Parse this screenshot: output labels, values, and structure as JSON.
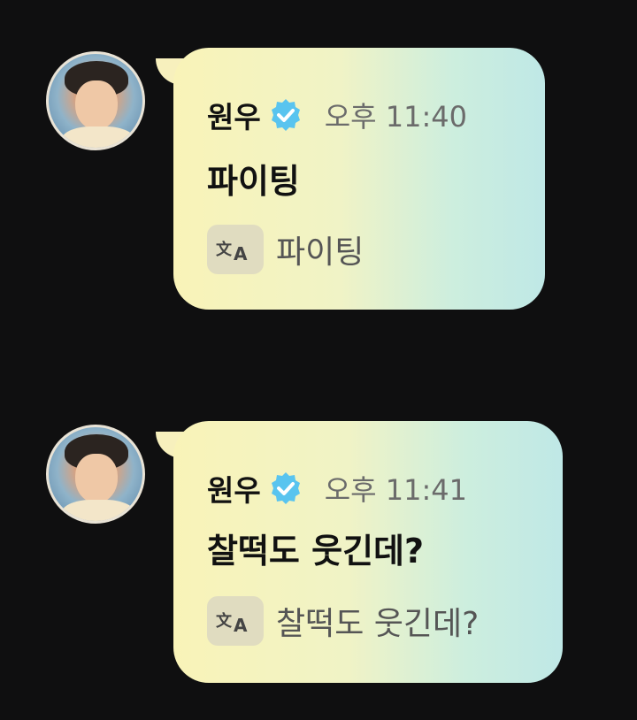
{
  "colors": {
    "background": "#0f0f10",
    "bubble_start": "#f9f3b8",
    "bubble_end": "#bfe8e6",
    "verified_badge": "#59c4ef"
  },
  "messages": [
    {
      "author": "원우",
      "verified_icon": "verified-badge-icon",
      "time": "오후 11:40",
      "text": "파이팅",
      "translate_icon": "translate-icon",
      "translation": "파이팅"
    },
    {
      "author": "원우",
      "verified_icon": "verified-badge-icon",
      "time": "오후 11:41",
      "text": "찰떡도 웃긴데?",
      "translate_icon": "translate-icon",
      "translation": "찰떡도 웃긴데?"
    }
  ]
}
